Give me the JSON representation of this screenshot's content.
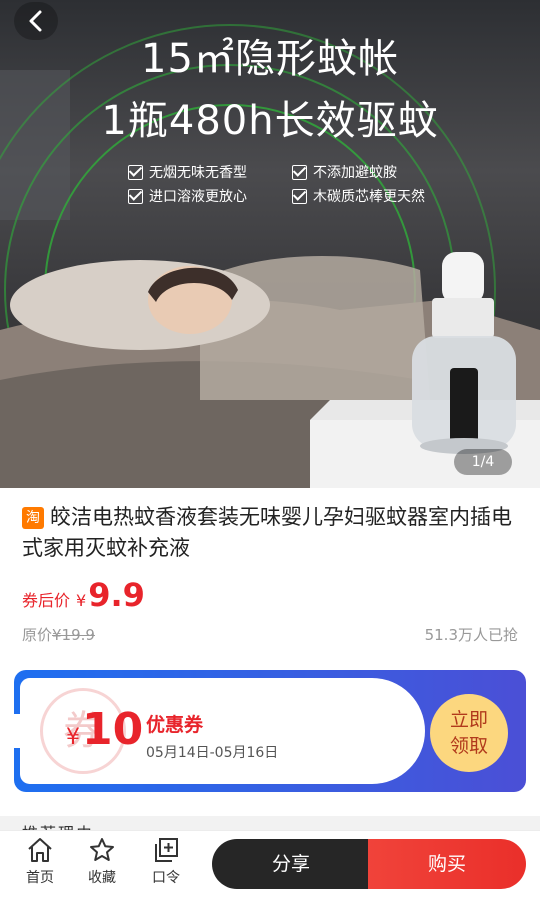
{
  "hero": {
    "title_line1": "15㎡隐形蚊帐",
    "title_line2": "1瓶480h长效驱蚊",
    "features": [
      "无烟无味无香型",
      "不添加避蚊胺",
      "进口溶液更放心",
      "木碳质芯棒更天然"
    ],
    "pager": "1/4",
    "back_icon": "chevron-left-icon"
  },
  "product": {
    "badge": "淘",
    "title": "皎洁电热蚊香液套装无味婴儿孕妇驱蚊器室内插电式家用灭蚊补充液",
    "price_label": "券后价",
    "currency": "¥",
    "price": "9.9",
    "original_label": "原价",
    "original_price": "¥19.9",
    "sold": "51.3万人已抢"
  },
  "coupon": {
    "stamp": "券",
    "currency": "¥",
    "amount": "10",
    "title": "优惠券",
    "date_range": "05月14日-05月16日",
    "claim_line1": "立即",
    "claim_line2": "领取"
  },
  "peek_text": "推荐理由",
  "bottom_nav": {
    "home": "首页",
    "favorite": "收藏",
    "code": "口令",
    "share": "分享",
    "buy": "购买"
  },
  "colors": {
    "accent_red": "#e8242b",
    "coupon_blue": "#1e6ff0",
    "claim_yellow": "#fcd77f",
    "taobao_orange": "#ff7a00"
  }
}
